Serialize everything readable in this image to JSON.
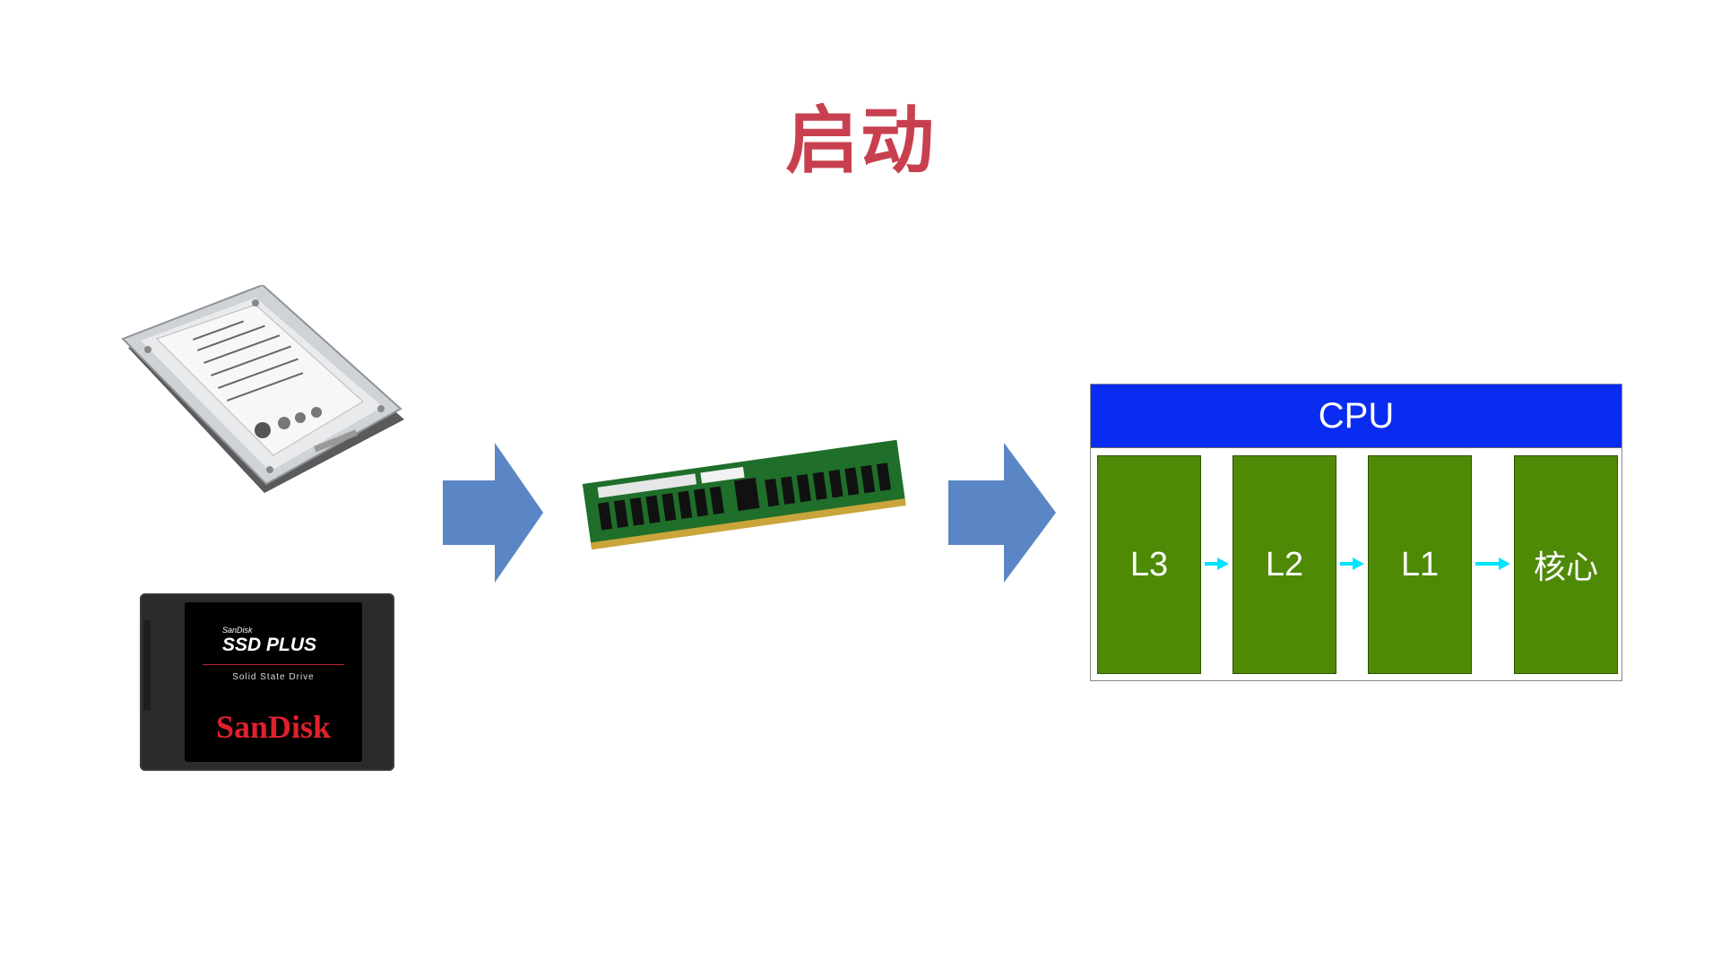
{
  "title": "启动",
  "storage": {
    "ssd": {
      "brand_small": "SanDisk",
      "product": "SSD PLUS",
      "subtitle": "Solid State Drive",
      "logo": "SanDisk"
    }
  },
  "cpu": {
    "header": "CPU",
    "blocks": [
      "L3",
      "L2",
      "L1",
      "核心"
    ]
  },
  "colors": {
    "title": "#c8404f",
    "arrow": "#5b86c5",
    "cpu_header": "#0a2cf0",
    "block": "#4e8a06",
    "connector": "#00e5ff"
  }
}
